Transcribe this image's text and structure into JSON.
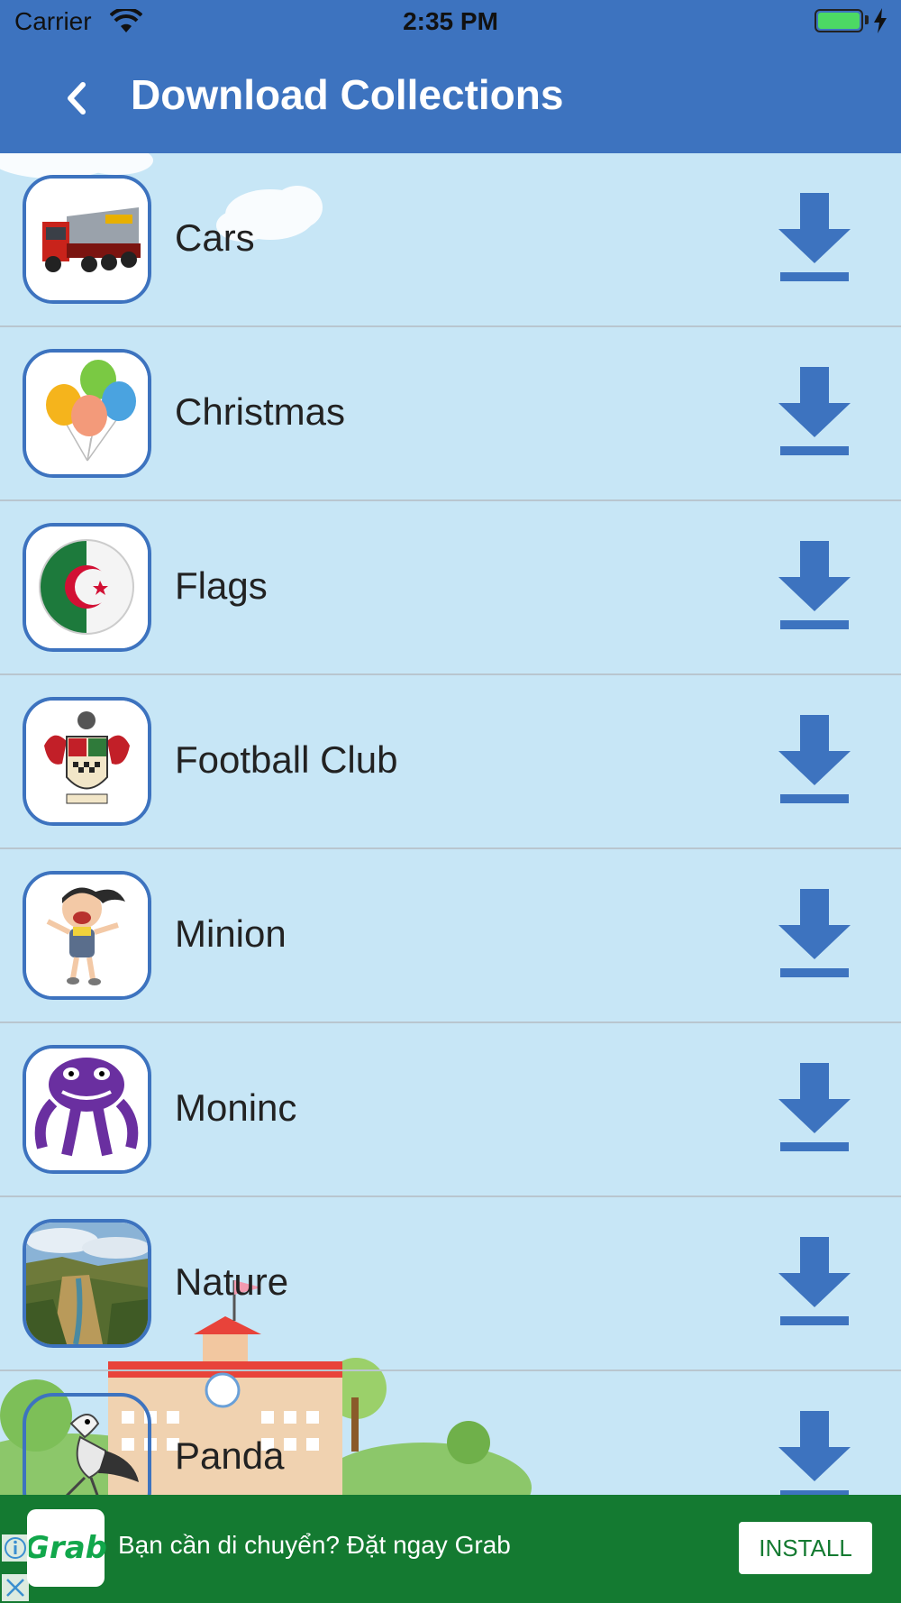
{
  "status_bar": {
    "carrier": "Carrier",
    "time": "2:35 PM"
  },
  "nav": {
    "title": "Download Collections",
    "back_icon": "chevron-left-icon"
  },
  "collections": [
    {
      "label": "Cars",
      "thumbnail": "dump-truck"
    },
    {
      "label": "Christmas",
      "thumbnail": "balloons"
    },
    {
      "label": "Flags",
      "thumbnail": "algeria-flag"
    },
    {
      "label": "Football Club",
      "thumbnail": "club-crest"
    },
    {
      "label": "Minion",
      "thumbnail": "girl-character"
    },
    {
      "label": "Moninc",
      "thumbnail": "purple-monster"
    },
    {
      "label": "Nature",
      "thumbnail": "canyon-landscape"
    },
    {
      "label": "Panda",
      "thumbnail": "bird-character"
    }
  ],
  "ad": {
    "brand": "Grab",
    "text": "Bạn cần di chuyển? Đặt ngay Grab",
    "install_label": "INSTALL"
  },
  "colors": {
    "primary": "#3d73bf",
    "background": "#c7e6f6",
    "ad_green": "#147a31"
  }
}
